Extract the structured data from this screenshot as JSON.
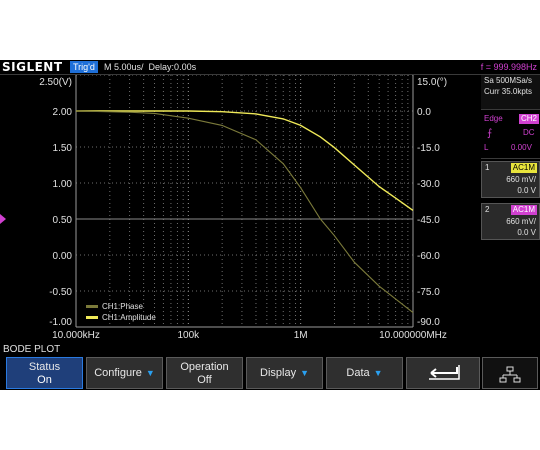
{
  "header": {
    "brand": "SIGLENT",
    "trigger_state": "Trig'd",
    "timebase": "M 5.00us/",
    "delay": "Delay:0.00s",
    "frequency": "f = 999.998Hz"
  },
  "acquisition": {
    "sample_rate": "Sa 500MSa/s",
    "memory": "Curr 35.0kpts"
  },
  "trigger": {
    "type": "Edge",
    "source": "CH2",
    "slope_icon": "rising-edge-icon",
    "coupling": "DC",
    "level_label": "L",
    "level": "0.00V"
  },
  "channels": [
    {
      "num": "1",
      "coupling": "AC1M",
      "scale": "660 mV/",
      "offset": "0.0 V"
    },
    {
      "num": "2",
      "coupling": "AC1M",
      "scale": "660 mV/",
      "offset": "0.0 V"
    }
  ],
  "menu": {
    "title": "BODE PLOT",
    "keys": [
      {
        "top": "Status",
        "bottom": "On",
        "selected": true
      },
      {
        "label": "Configure",
        "arrow": true
      },
      {
        "top": "Operation",
        "bottom": "Off"
      },
      {
        "label": "Display",
        "arrow": true
      },
      {
        "label": "Data",
        "arrow": true
      },
      {
        "icon": "return-arrow-icon"
      },
      {
        "icon": "network-icon"
      }
    ]
  },
  "colors": {
    "amplitude": "#f0ea58",
    "phase": "#7b7a3a",
    "accent": "#1e6fd8",
    "magenta": "#d040d0"
  },
  "chart_data": {
    "type": "line",
    "x_scale": "log",
    "x_ticks": [
      "10.000kHz",
      "100k",
      "1M",
      "10.000000MHz"
    ],
    "x_range": [
      10000,
      10000000
    ],
    "y_left_ticks": [
      "2.50(V)",
      "2.00",
      "1.50",
      "1.00",
      "0.50",
      "0.00",
      "-0.50",
      "-1.00"
    ],
    "y_left_range": [
      -1.0,
      2.5
    ],
    "y_right_ticks": [
      "15.0(°)",
      "0.0",
      "-15.0",
      "-30.0",
      "-45.0",
      "-60.0",
      "-75.0",
      "-90.0"
    ],
    "y_right_range": [
      -90,
      15
    ],
    "legend": [
      "CH1:Phase",
      "CH1:Amplitude"
    ],
    "series": [
      {
        "name": "CH1:Amplitude",
        "axis": "left",
        "x": [
          10000,
          30000,
          100000,
          200000,
          400000,
          700000,
          1000000,
          1500000,
          2000000,
          3000000,
          5000000,
          7000000,
          10000000
        ],
        "y": [
          2.0,
          2.0,
          2.0,
          1.99,
          1.96,
          1.89,
          1.8,
          1.64,
          1.49,
          1.25,
          0.95,
          0.79,
          0.62
        ]
      },
      {
        "name": "CH1:Phase",
        "axis": "right",
        "x": [
          10000,
          30000,
          50000,
          100000,
          200000,
          400000,
          700000,
          1000000,
          1500000,
          2000000,
          3000000,
          5000000,
          10000000
        ],
        "y": [
          0,
          -0.5,
          -1,
          -3,
          -6,
          -12,
          -22,
          -32,
          -45,
          -52,
          -63,
          -73,
          -84
        ]
      }
    ]
  }
}
